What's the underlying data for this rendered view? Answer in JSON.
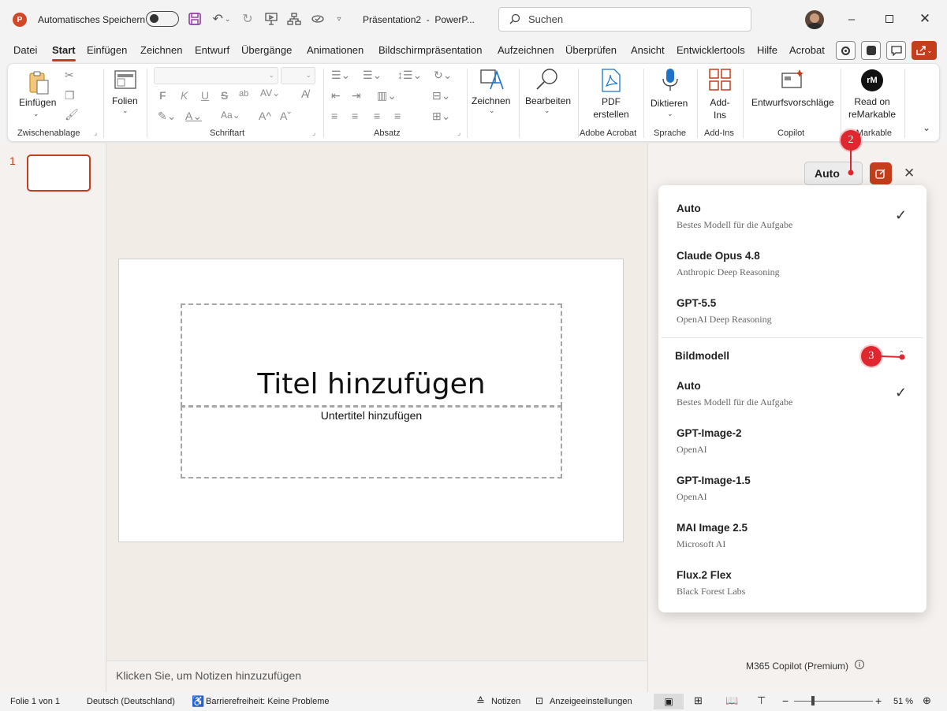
{
  "titlebar": {
    "autosave_label": "Automatisches Speichern",
    "doc_title": "Präsentation2  -  PowerP...",
    "search_placeholder": "Suchen"
  },
  "menu": {
    "items": [
      "Datei",
      "Start",
      "Einfügen",
      "Zeichnen",
      "Entwurf",
      "Übergänge",
      "Animationen",
      "Bildschirmpräsentation",
      "Aufzeichnen",
      "Überprüfen",
      "Ansicht",
      "Entwicklertools",
      "Hilfe",
      "Acrobat"
    ],
    "active": "Start"
  },
  "ribbon": {
    "clipboard": {
      "paste": "Einfügen",
      "label": "Zwischenablage"
    },
    "slides": {
      "new_slide": "Folien"
    },
    "font": {
      "label": "Schriftart",
      "bold": "F",
      "italic": "K",
      "underline": "U",
      "strike": "S"
    },
    "paragraph": {
      "label": "Absatz"
    },
    "drawing": {
      "label": "Zeichnen"
    },
    "editing": {
      "label": "Bearbeiten"
    },
    "acrobat": {
      "btn_line1": "PDF",
      "btn_line2": "erstellen",
      "label": "Adobe Acrobat"
    },
    "voice": {
      "btn": "Diktieren",
      "label": "Sprache"
    },
    "addins": {
      "btn_line1": "Add-",
      "btn_line2": "Ins",
      "label": "Add-Ins"
    },
    "copilot": {
      "btn": "Entwurfsvorschläge",
      "label": "Copilot"
    },
    "remarkable": {
      "btn_line1": "Read on",
      "btn_line2": "reMarkable",
      "label": "reMarkable",
      "logo": "rM"
    }
  },
  "thumbs": {
    "slide_number": "1"
  },
  "slide": {
    "title_placeholder": "Titel hinzufügen",
    "subtitle_placeholder": "Untertitel hinzufügen"
  },
  "notes": {
    "placeholder": "Klicken Sie, um Notizen hinzuzufügen"
  },
  "copilot_pane": {
    "model_button": "Auto",
    "footer": "M365 Copilot (Premium)"
  },
  "model_menu": {
    "models": [
      {
        "name": "Auto",
        "desc": "Bestes Modell für die Aufgabe",
        "selected": true
      },
      {
        "name": "Claude Opus 4.8",
        "desc": "Anthropic Deep Reasoning",
        "selected": false
      },
      {
        "name": "GPT-5.5",
        "desc": "OpenAI Deep Reasoning",
        "selected": false
      }
    ],
    "image_section_title": "Bildmodell",
    "image_models": [
      {
        "name": "Auto",
        "desc": "Bestes Modell für die Aufgabe",
        "selected": true
      },
      {
        "name": "GPT-Image-2",
        "desc": "OpenAI",
        "selected": false
      },
      {
        "name": "GPT-Image-1.5",
        "desc": "OpenAI",
        "selected": false
      },
      {
        "name": "MAI Image 2.5",
        "desc": "Microsoft AI",
        "selected": false
      },
      {
        "name": "Flux.2 Flex",
        "desc": "Black Forest Labs",
        "selected": false
      }
    ]
  },
  "annotations": {
    "badge_a": "2",
    "badge_b": "3"
  },
  "statusbar": {
    "slide_count": "Folie 1 von 1",
    "language": "Deutsch (Deutschland)",
    "accessibility": "Barrierefreiheit: Keine Probleme",
    "notes": "Notizen",
    "display_settings": "Anzeigeeinstellungen",
    "zoom": "51 %"
  },
  "colors": {
    "accent": "#c43e1c",
    "annotation": "#e0262e"
  }
}
